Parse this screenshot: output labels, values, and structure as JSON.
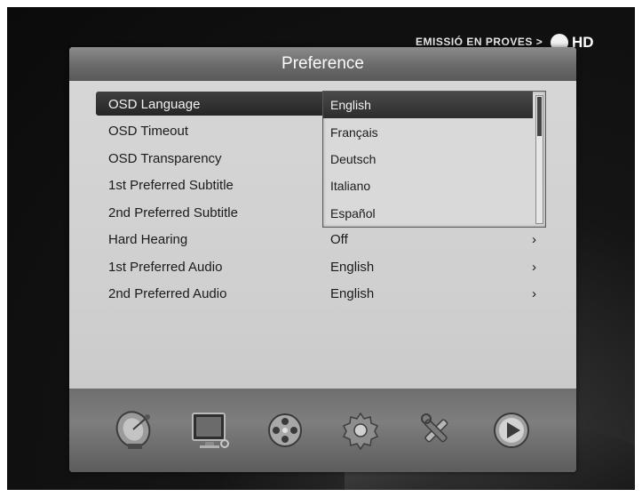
{
  "tv": {
    "channel_banner": "EMISSIÓ EN PROVES >",
    "hd_label": "HD"
  },
  "panel": {
    "title": "Preference"
  },
  "menu": {
    "items": [
      {
        "label": "OSD Language",
        "value": "",
        "arrow": ""
      },
      {
        "label": "OSD Timeout",
        "value": "",
        "arrow": ""
      },
      {
        "label": "OSD Transparency",
        "value": "",
        "arrow": ""
      },
      {
        "label": "1st Preferred Subtitle",
        "value": "",
        "arrow": ""
      },
      {
        "label": "2nd Preferred Subtitle",
        "value": "",
        "arrow": ""
      },
      {
        "label": "Hard Hearing",
        "value": "Off",
        "arrow": "›"
      },
      {
        "label": "1st Preferred Audio",
        "value": "English",
        "arrow": "›"
      },
      {
        "label": "2nd Preferred Audio",
        "value": "English",
        "arrow": "›"
      }
    ],
    "selected_index": 0
  },
  "language_dropdown": {
    "options": [
      "English",
      "Français",
      "Deutsch",
      "Italiano",
      "Español"
    ],
    "selected_index": 0
  },
  "dock": {
    "icons": [
      "satellite-dish-icon",
      "tv-monitor-icon",
      "film-reel-icon",
      "settings-gear-icon",
      "tools-icon",
      "play-icon"
    ]
  },
  "colors": {
    "panel_bg": "#cfcfcf",
    "title_bar": "#6a6a6a",
    "highlight": "#2d2d2d",
    "screen_bg": "#0b0b0b"
  }
}
